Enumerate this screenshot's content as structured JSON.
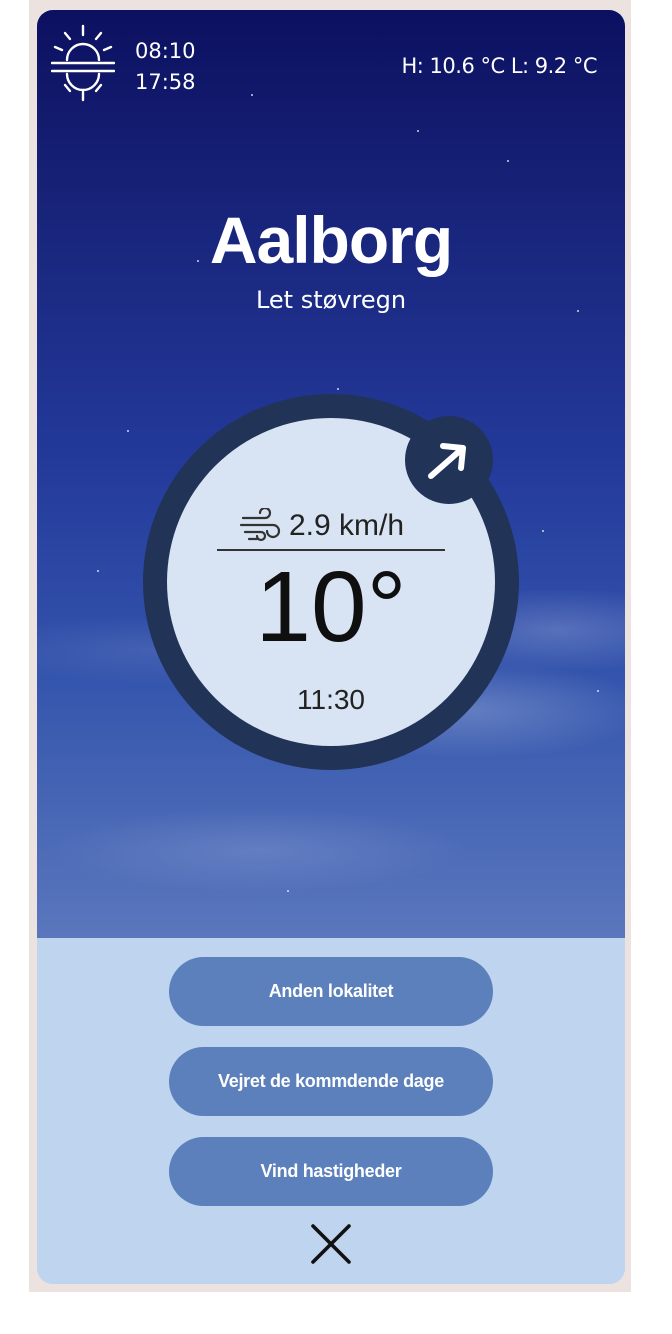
{
  "header": {
    "sunrise": "08:10",
    "sunset": "17:58",
    "high_low": "H: 10.6 °C L: 9.2 °C",
    "icon": "sunrise-sunset-icon"
  },
  "location": {
    "city": "Aalborg",
    "description": "Let støvregn"
  },
  "dial": {
    "wind_speed": "2.9 km/h",
    "wind_icon": "wind-icon",
    "temperature": "10°",
    "time": "11:30",
    "direction_icon": "arrow-up-right-icon"
  },
  "menu": {
    "items": [
      {
        "label": "Anden lokalitet"
      },
      {
        "label": "Vejret de kommdende dage"
      },
      {
        "label": "Vind hastigheder"
      }
    ],
    "close_icon": "close-icon"
  },
  "colors": {
    "dial_ring": "#223358",
    "dial_face": "#d8e3f3",
    "button": "#5b80bb",
    "menu_bg": "#bfd4ef"
  }
}
